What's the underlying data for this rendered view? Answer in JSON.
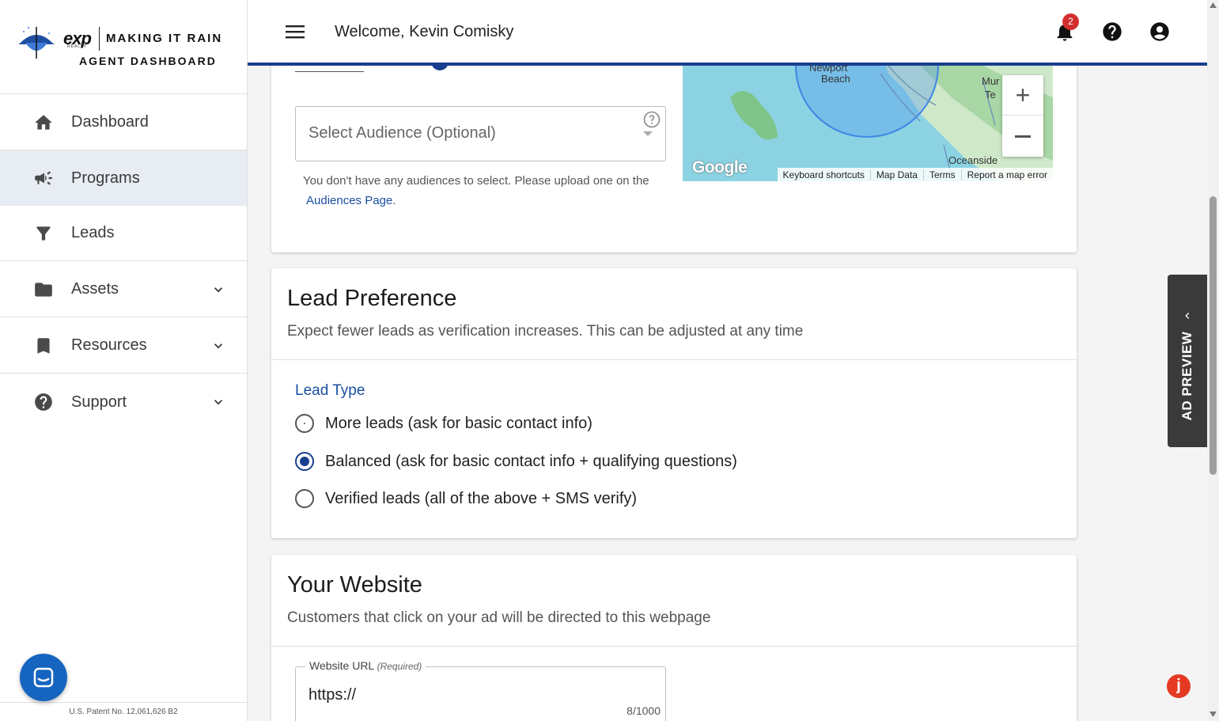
{
  "brand": {
    "logo_exp": "exp",
    "logo_realty": "REALTY",
    "logo_title": "MAKING IT RAIN",
    "logo_subtitle": "AGENT DASHBOARD"
  },
  "sidebar": {
    "items": [
      {
        "label": "Dashboard",
        "icon": "home-icon"
      },
      {
        "label": "Programs",
        "icon": "megaphone-icon",
        "active": true
      },
      {
        "label": "Leads",
        "icon": "funnel-icon"
      },
      {
        "label": "Assets",
        "icon": "folder-icon",
        "expandable": true
      },
      {
        "label": "Resources",
        "icon": "bookmark-icon",
        "expandable": true
      },
      {
        "label": "Support",
        "icon": "help-circle-icon",
        "expandable": true
      }
    ],
    "patent": "U.S. Patent No. 12,061,626 B2"
  },
  "header": {
    "welcome": "Welcome, Kevin Comisky",
    "notification_count": "2",
    "icons": [
      "menu-icon",
      "bell-icon",
      "help-icon",
      "account-icon"
    ]
  },
  "audience": {
    "select_placeholder": "Select Audience (Optional)",
    "helper_text": "You don't have any audiences to select. Please upload one on the",
    "helper_link": "Audiences Page",
    "helper_end": "."
  },
  "map": {
    "labels": [
      "Newport",
      "Beach",
      "Mur",
      "Te",
      "Oceanside"
    ],
    "attribution": [
      "Keyboard shortcuts",
      "Map Data",
      "Terms",
      "Report a map error"
    ],
    "google_logo": "Google"
  },
  "lead_preference": {
    "title": "Lead Preference",
    "subtitle": "Expect fewer leads as verification increases. This can be adjusted at any time",
    "lead_type_label": "Lead Type",
    "options": [
      {
        "label": "More leads (ask for basic contact info)",
        "selected": false
      },
      {
        "label": "Balanced (ask for basic contact info + qualifying questions)",
        "selected": true
      },
      {
        "label": "Verified leads (all of the above + SMS verify)",
        "selected": false
      }
    ]
  },
  "website": {
    "title": "Your Website",
    "subtitle": "Customers that click on your ad will be directed to this webpage",
    "url_label": "Website URL",
    "url_required": "(Required)",
    "url_value": "https://",
    "char_count": "8/1000"
  },
  "ad_preview": {
    "label": "AD PREVIEW"
  },
  "colors": {
    "primary": "#1a3e8f",
    "link": "#1a4fa0",
    "badge": "#d32f2f",
    "chat": "#1565c0"
  }
}
